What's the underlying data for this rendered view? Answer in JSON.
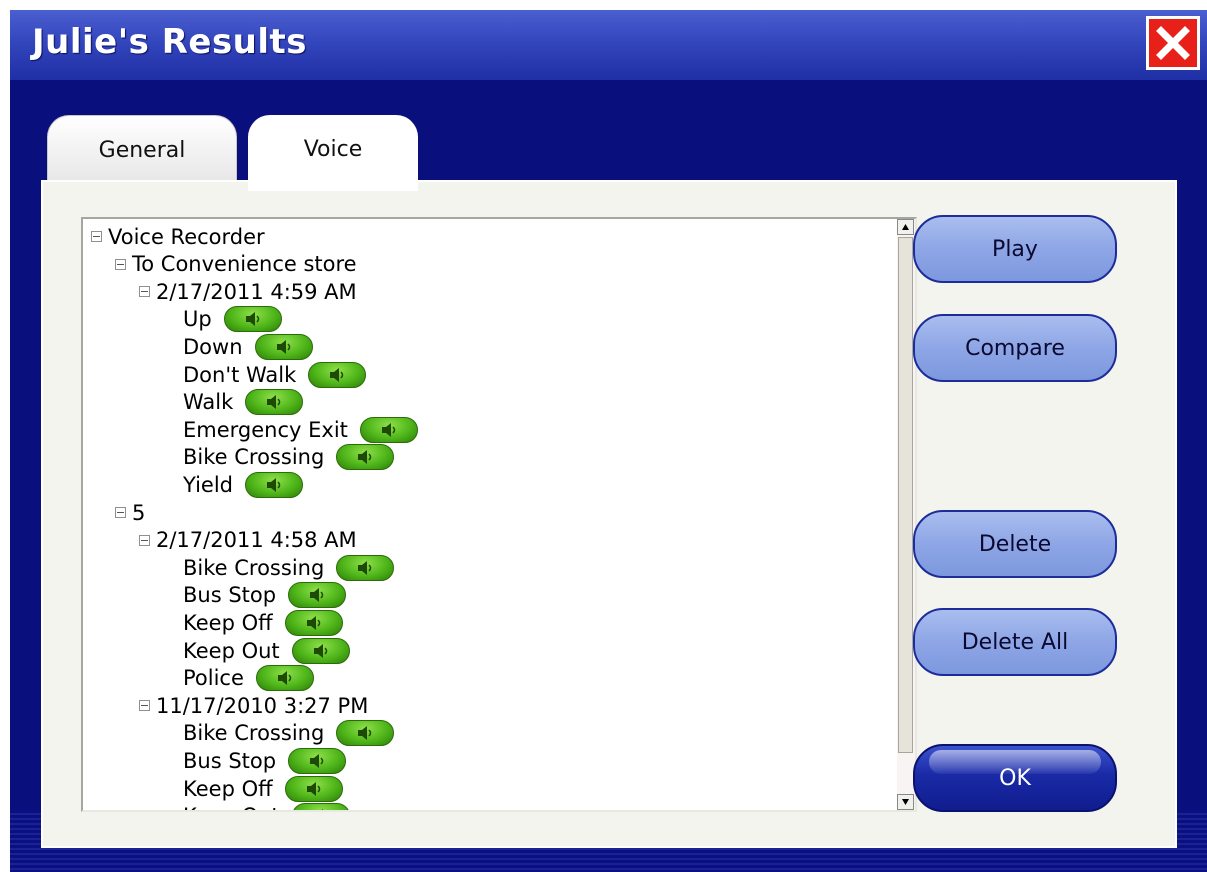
{
  "window": {
    "title": "Julie's Results",
    "close_icon": "close-icon"
  },
  "tabs": [
    {
      "label": "General",
      "selected": false
    },
    {
      "label": "Voice",
      "selected": true
    }
  ],
  "tree": {
    "root": "Voice Recorder",
    "groups": [
      {
        "name": "To Convenience store",
        "sessions": [
          {
            "date": "2/17/2011 4:59 AM",
            "items": [
              "Up",
              "Down",
              "Don't Walk",
              "Walk",
              "Emergency Exit",
              "Bike Crossing",
              "Yield"
            ]
          }
        ]
      },
      {
        "name": "5",
        "sessions": [
          {
            "date": "2/17/2011 4:58 AM",
            "items": [
              "Bike Crossing",
              "Bus Stop",
              "Keep Off",
              "Keep Out",
              "Police"
            ]
          },
          {
            "date": "11/17/2010 3:27 PM",
            "items": [
              "Bike Crossing",
              "Bus Stop",
              "Keep Off",
              "Keep Out"
            ]
          }
        ]
      }
    ],
    "item_icon": "speaker-icon"
  },
  "buttons": {
    "play": "Play",
    "compare": "Compare",
    "delete": "Delete",
    "delete_all": "Delete All",
    "ok": "OK"
  },
  "colors": {
    "window_background": "#0a0f7e",
    "title_bar": "#3446bd",
    "close_button": "#e8201a",
    "speaker_green": "#4fb61a",
    "button_light_blue": "#8ea6e6",
    "button_ok_blue": "#1a2aa6"
  }
}
